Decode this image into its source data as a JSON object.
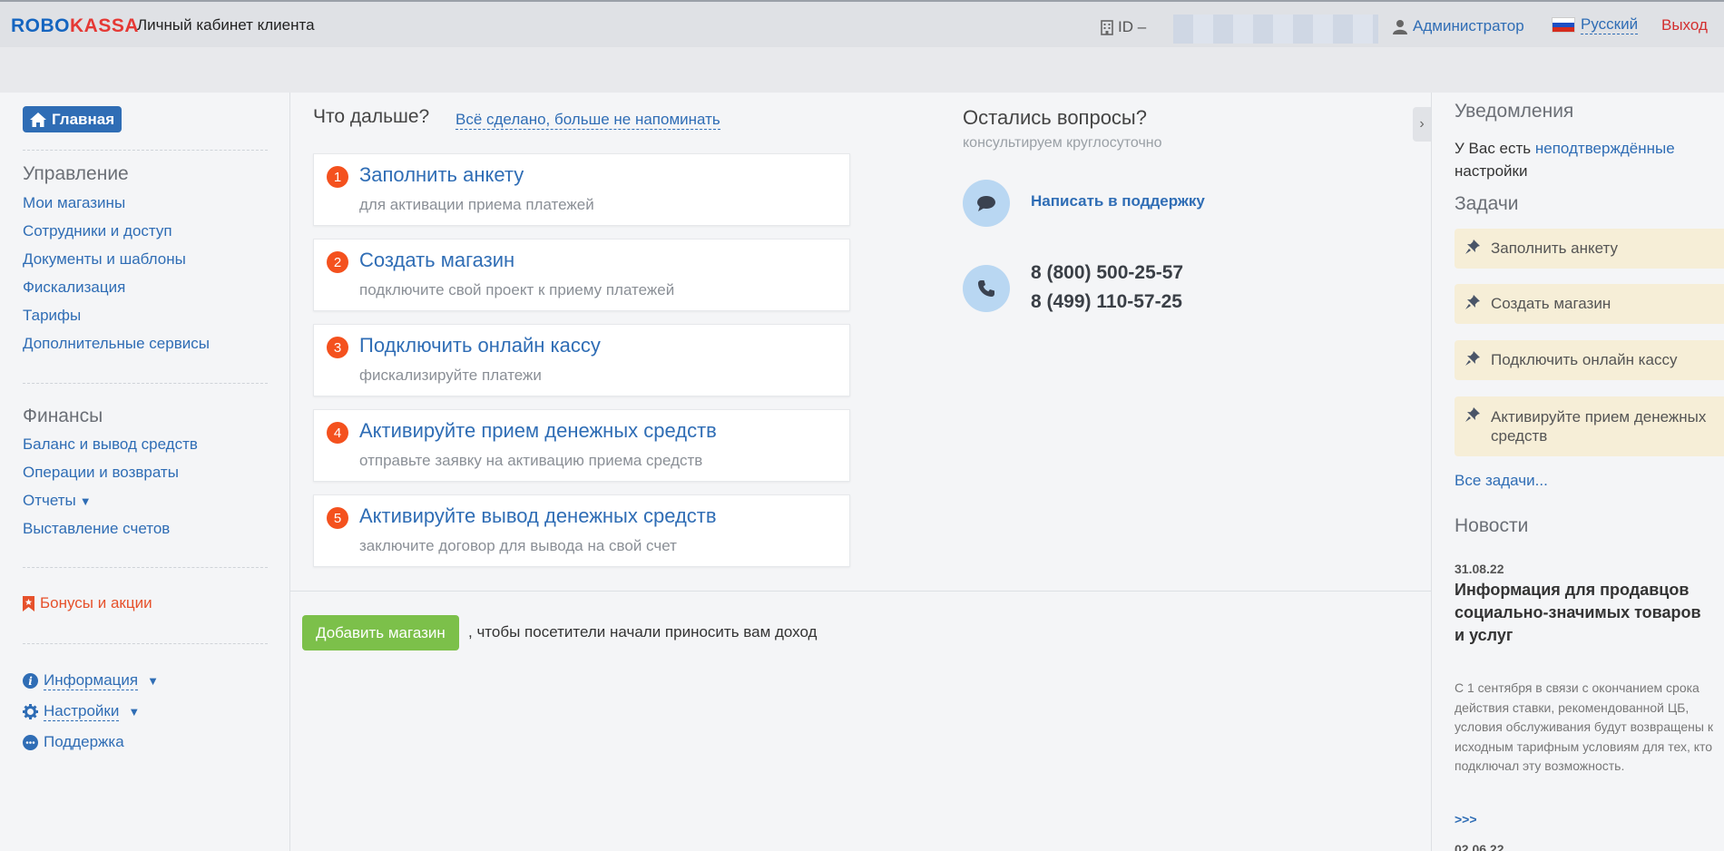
{
  "header": {
    "logo_robo": "ROBO",
    "logo_kassa": "KASSA",
    "title": "Личный кабинет клиента",
    "id_label": "ID –",
    "user": "Администратор",
    "language": "Русский",
    "logout": "Выход"
  },
  "sidebar": {
    "home": "Главная",
    "management_title": "Управление",
    "management_items": [
      "Мои магазины",
      "Сотрудники и доступ",
      "Документы и шаблоны",
      "Фискализация",
      "Тарифы",
      "Дополнительные сервисы"
    ],
    "finance_title": "Финансы",
    "finance_items": [
      "Баланс и вывод средств",
      "Операции и возвраты",
      "Отчеты",
      "Выставление счетов"
    ],
    "bonuses": "Бонусы и акции",
    "info": "Информация",
    "settings": "Настройки",
    "support": "Поддержка"
  },
  "main": {
    "next_title": "Что дальше?",
    "done_link": "Всё сделано, больше не напоминать",
    "steps": [
      {
        "num": "1",
        "title": "Заполнить анкету",
        "sub": "для активации приема платежей"
      },
      {
        "num": "2",
        "title": "Создать магазин",
        "sub": "подключите свой проект к приему платежей"
      },
      {
        "num": "3",
        "title": "Подключить онлайн кассу",
        "sub": "фискализируйте платежи"
      },
      {
        "num": "4",
        "title": "Активируйте прием денежных средств",
        "sub": "отправьте заявку на активацию приема средств"
      },
      {
        "num": "5",
        "title": "Активируйте вывод денежных средств",
        "sub": "заключите договор для вывода на свой счет"
      }
    ],
    "questions_title": "Остались вопросы?",
    "questions_sub": "консультируем круглосуточно",
    "support_link": "Написать в поддержку",
    "phones": [
      "8 (800) 500-25-57",
      "8 (499) 110-57-25"
    ],
    "add_shop_button": "Добавить магазин",
    "add_shop_text": ", чтобы посетители начали приносить вам доход"
  },
  "right": {
    "notifications_title": "Уведомления",
    "notif_pre": "У Вас есть ",
    "notif_link": "неподтверждённые",
    "notif_post": " настройки",
    "tasks_title": "Задачи",
    "tasks": [
      "Заполнить анкету",
      "Создать магазин",
      "Подключить онлайн кассу",
      "Активируйте прием денежных средств"
    ],
    "all_tasks": "Все задачи...",
    "news_title": "Новости",
    "news_date": "31.08.22",
    "news_headline": "Информация для продавцов социально-значимых товаров и услуг",
    "news_body": "С 1 сентября в связи с окончанием срока действия ставки, рекомендованной ЦБ, условия обслуживания будут возвращены к исходным тарифным условиям для тех, кто подключал эту возможность.",
    "news_more": ">>>",
    "news_date_2": "02.06.22"
  }
}
